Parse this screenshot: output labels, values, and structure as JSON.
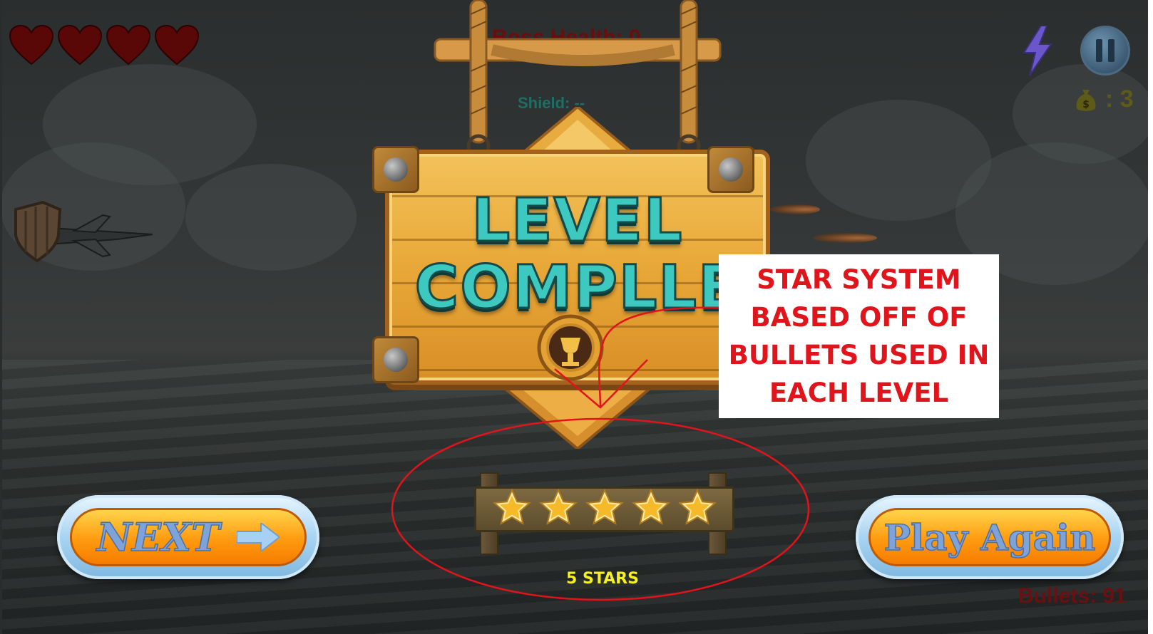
{
  "hud": {
    "lives": 4,
    "boss_health_text": "Boss Health: 0",
    "shield_text": "Shield: --",
    "coins_text": ": 3",
    "bullets_text": "Bullets: 91",
    "icons": {
      "life": "heart-icon",
      "power": "lightning-icon",
      "pause": "pause-icon",
      "coins": "money-bag-icon"
    }
  },
  "sign": {
    "line1": "LEVEL",
    "line2": "COMPLLE"
  },
  "annotation": {
    "lines": [
      "STAR SYSTEM",
      "BASED OFF OF",
      "BULLETS USED IN",
      "EACH LEVEL"
    ]
  },
  "rating": {
    "stars_earned": 5,
    "stars_total": 5,
    "label": "5 STARS"
  },
  "buttons": {
    "next_label": "NEXT",
    "play_again_label": "Play Again"
  },
  "colors": {
    "annotation_red": "#e0141b",
    "stars_label_yellow": "#f4f022",
    "title_teal": "#3ec9c0",
    "button_orange": "#ff9a10"
  }
}
